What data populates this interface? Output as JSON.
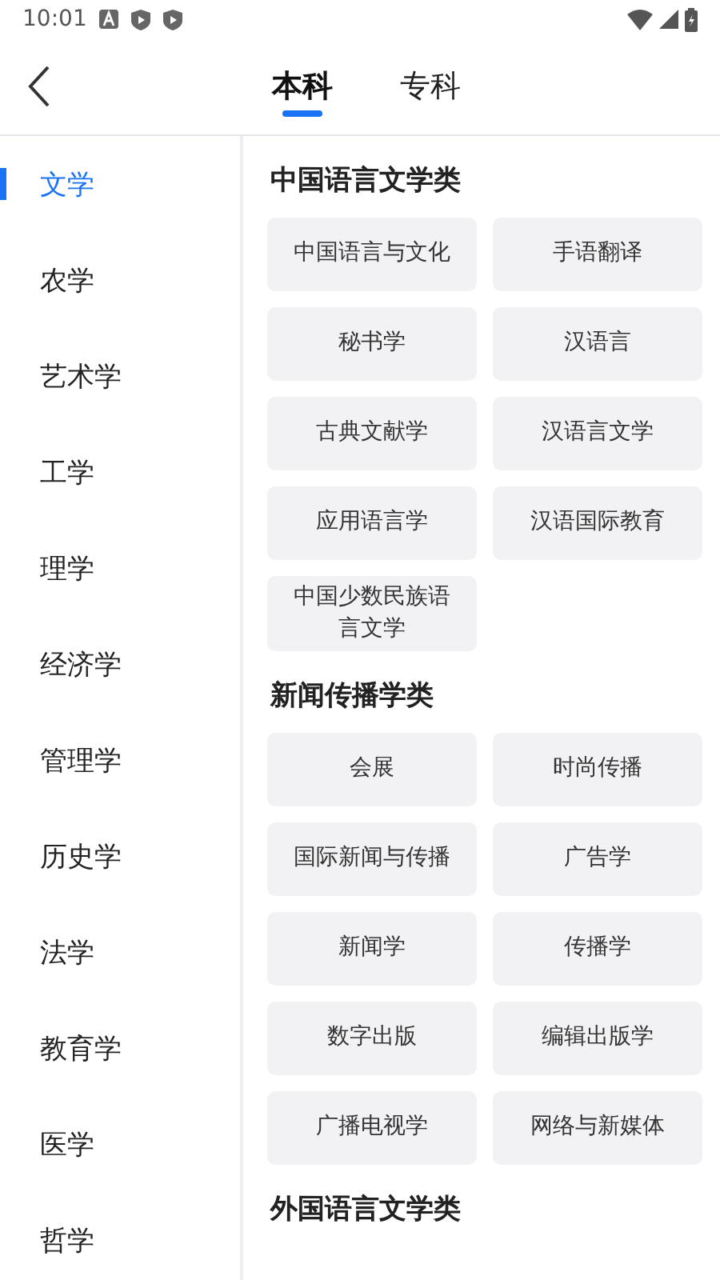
{
  "status_bar": {
    "time": "10:01"
  },
  "tabs": [
    {
      "label": "本科",
      "selected": true
    },
    {
      "label": "专科",
      "selected": false
    }
  ],
  "sidebar": {
    "items": [
      {
        "label": "文学",
        "selected": true
      },
      {
        "label": "农学",
        "selected": false
      },
      {
        "label": "艺术学",
        "selected": false
      },
      {
        "label": "工学",
        "selected": false
      },
      {
        "label": "理学",
        "selected": false
      },
      {
        "label": "经济学",
        "selected": false
      },
      {
        "label": "管理学",
        "selected": false
      },
      {
        "label": "历史学",
        "selected": false
      },
      {
        "label": "法学",
        "selected": false
      },
      {
        "label": "教育学",
        "selected": false
      },
      {
        "label": "医学",
        "selected": false
      },
      {
        "label": "哲学",
        "selected": false
      }
    ]
  },
  "sections": [
    {
      "title": "中国语言文学类",
      "majors": [
        "中国语言与文化",
        "手语翻译",
        "秘书学",
        "汉语言",
        "古典文献学",
        "汉语言文学",
        "应用语言学",
        "汉语国际教育",
        "中国少数民族语言文学"
      ]
    },
    {
      "title": "新闻传播学类",
      "majors": [
        "会展",
        "时尚传播",
        "国际新闻与传播",
        "广告学",
        "新闻学",
        "传播学",
        "数字出版",
        "编辑出版学",
        "广播电视学",
        "网络与新媒体"
      ]
    },
    {
      "title": "外国语言文学类"
    }
  ]
}
